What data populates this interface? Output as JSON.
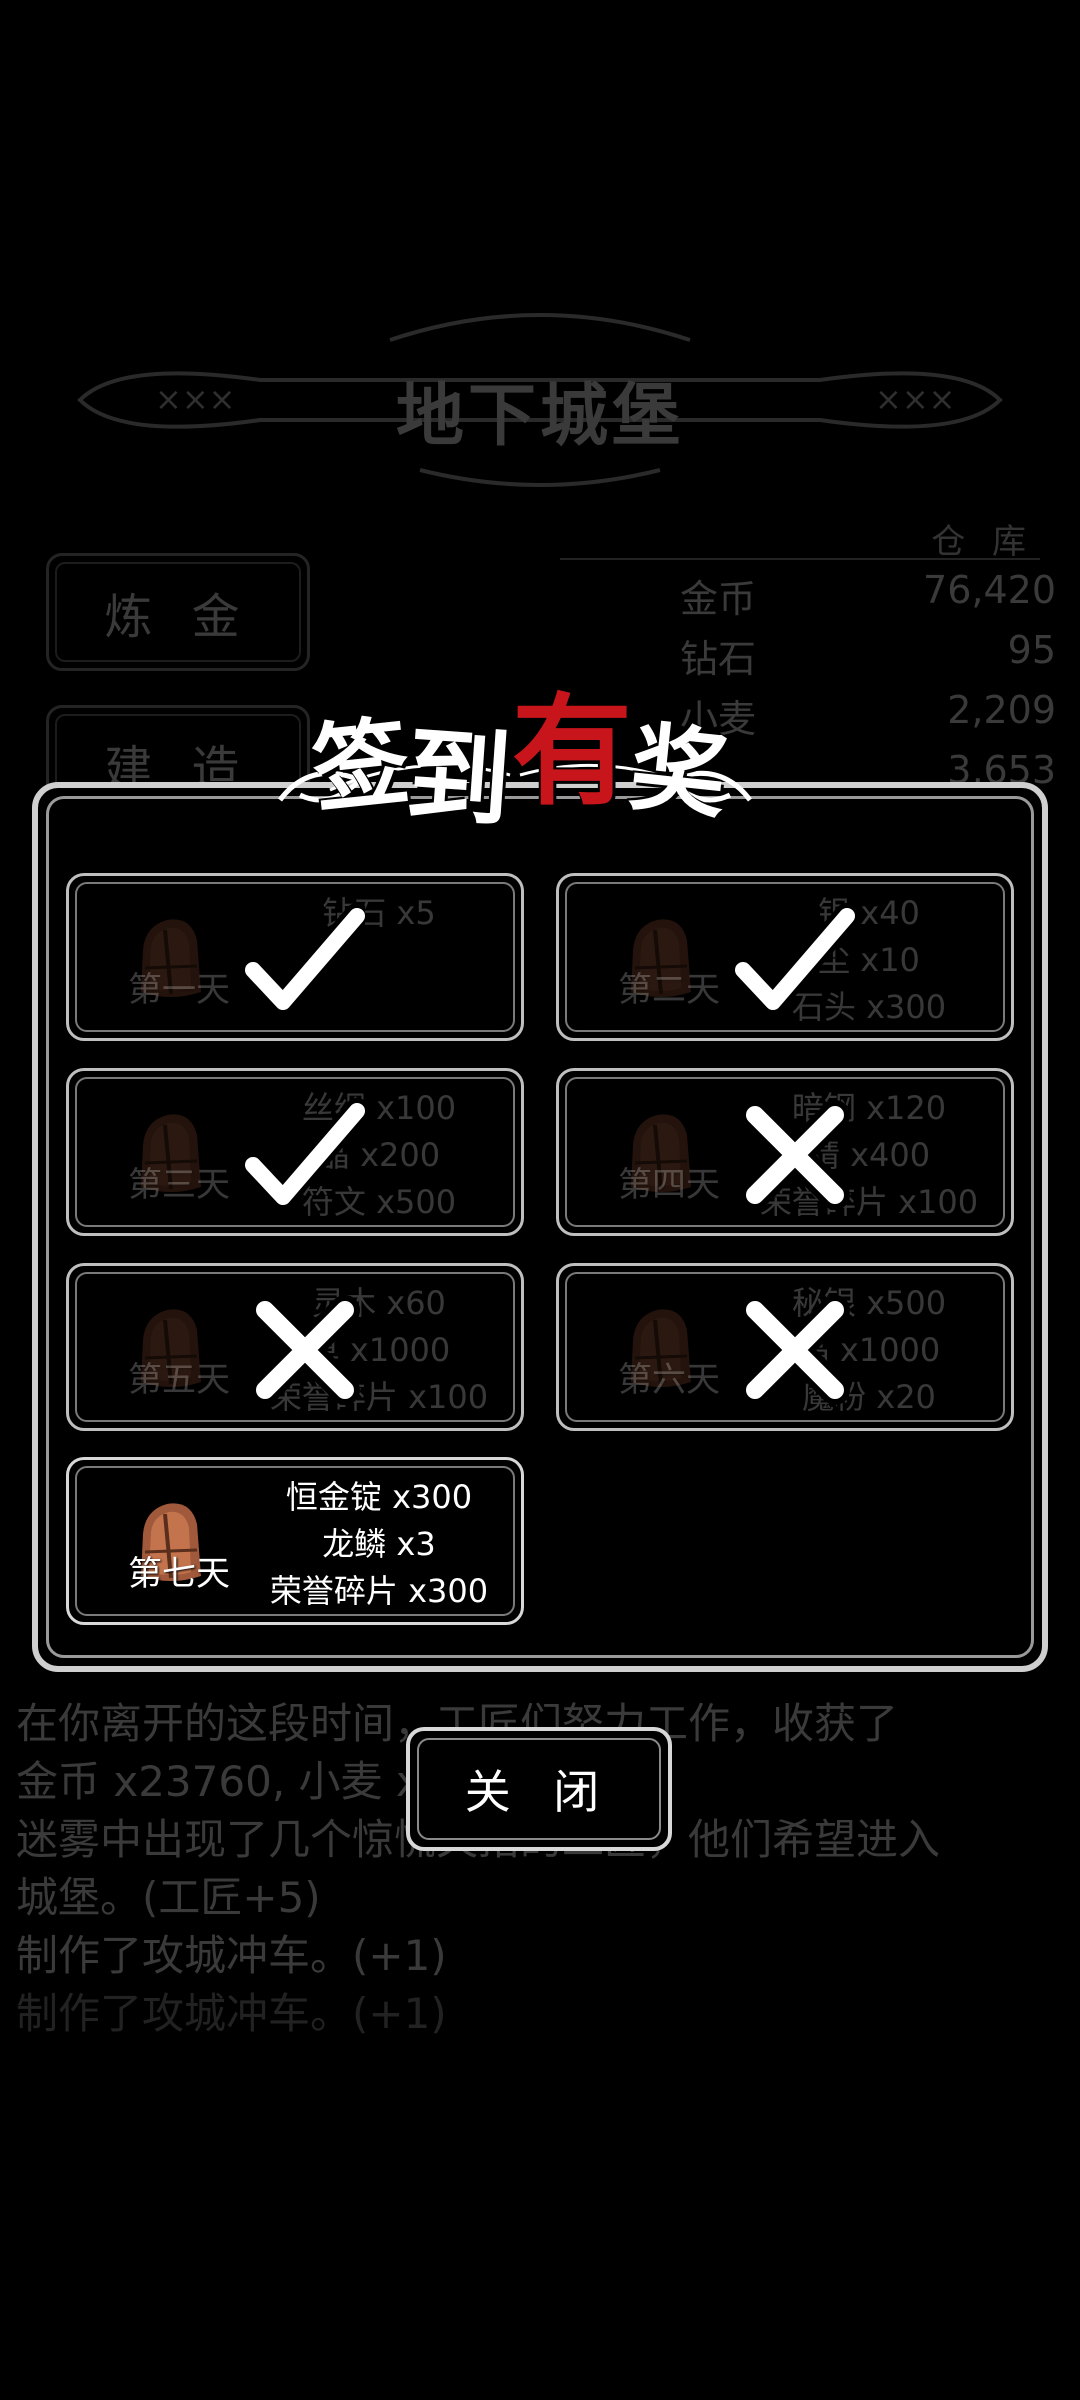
{
  "background": {
    "game_title": "地下城堡",
    "buttons": [
      "炼 金",
      "建 造"
    ],
    "warehouse": {
      "header": "仓 库",
      "rows": [
        {
          "name": "金币",
          "value": "76,420"
        },
        {
          "name": "钻石",
          "value": "95"
        },
        {
          "name": "小麦",
          "value": "2,209"
        },
        {
          "name": "",
          "value": "3,653"
        }
      ]
    },
    "log_lines": [
      "在你离开的这段时间，工匠们努力工作，收获了",
      "金币 x23760, 小麦 x10",
      "迷雾中出现了几个惊慌失措的工匠，他们希望进入",
      "城堡。(工匠+5)",
      "制作了攻城冲车。(+1)",
      "制作了攻城冲车。(+1)"
    ]
  },
  "popup": {
    "title_chars": [
      "签",
      "到",
      "有",
      "奖"
    ],
    "days": [
      {
        "label": "第一天",
        "rewards": [
          "钻石 x5",
          "",
          ""
        ],
        "status": "check"
      },
      {
        "label": "第二天",
        "rewards": [
          "银 x40",
          "尘 x10",
          "石头 x300"
        ],
        "status": "check"
      },
      {
        "label": "第三天",
        "rewards": [
          "丝绸 x100",
          "晶 x200",
          "符文 x500"
        ],
        "status": "check"
      },
      {
        "label": "第四天",
        "rewards": [
          "暗钢 x120",
          "精 x400",
          "荣誉碎片 x100"
        ],
        "status": "cross"
      },
      {
        "label": "第五天",
        "rewards": [
          "灵木 x60",
          "草 x1000",
          "荣誉碎片 x100"
        ],
        "status": "cross"
      },
      {
        "label": "第六天",
        "rewards": [
          "秘银 x500",
          "晶 x1000",
          "魔粉 x20"
        ],
        "status": "cross"
      },
      {
        "label": "第七天",
        "rewards": [
          "恒金锭 x300",
          "龙鳞 x3",
          "荣誉碎片 x300"
        ],
        "status": "available"
      }
    ],
    "close_label": "关 闭"
  },
  "colors": {
    "accent_red": "#c8151b",
    "border": "#d8d8d8",
    "chest": "#a0593a"
  },
  "icons": {
    "check": "checkmark-icon",
    "cross": "cross-icon",
    "chest": "treasure-chest-icon"
  }
}
